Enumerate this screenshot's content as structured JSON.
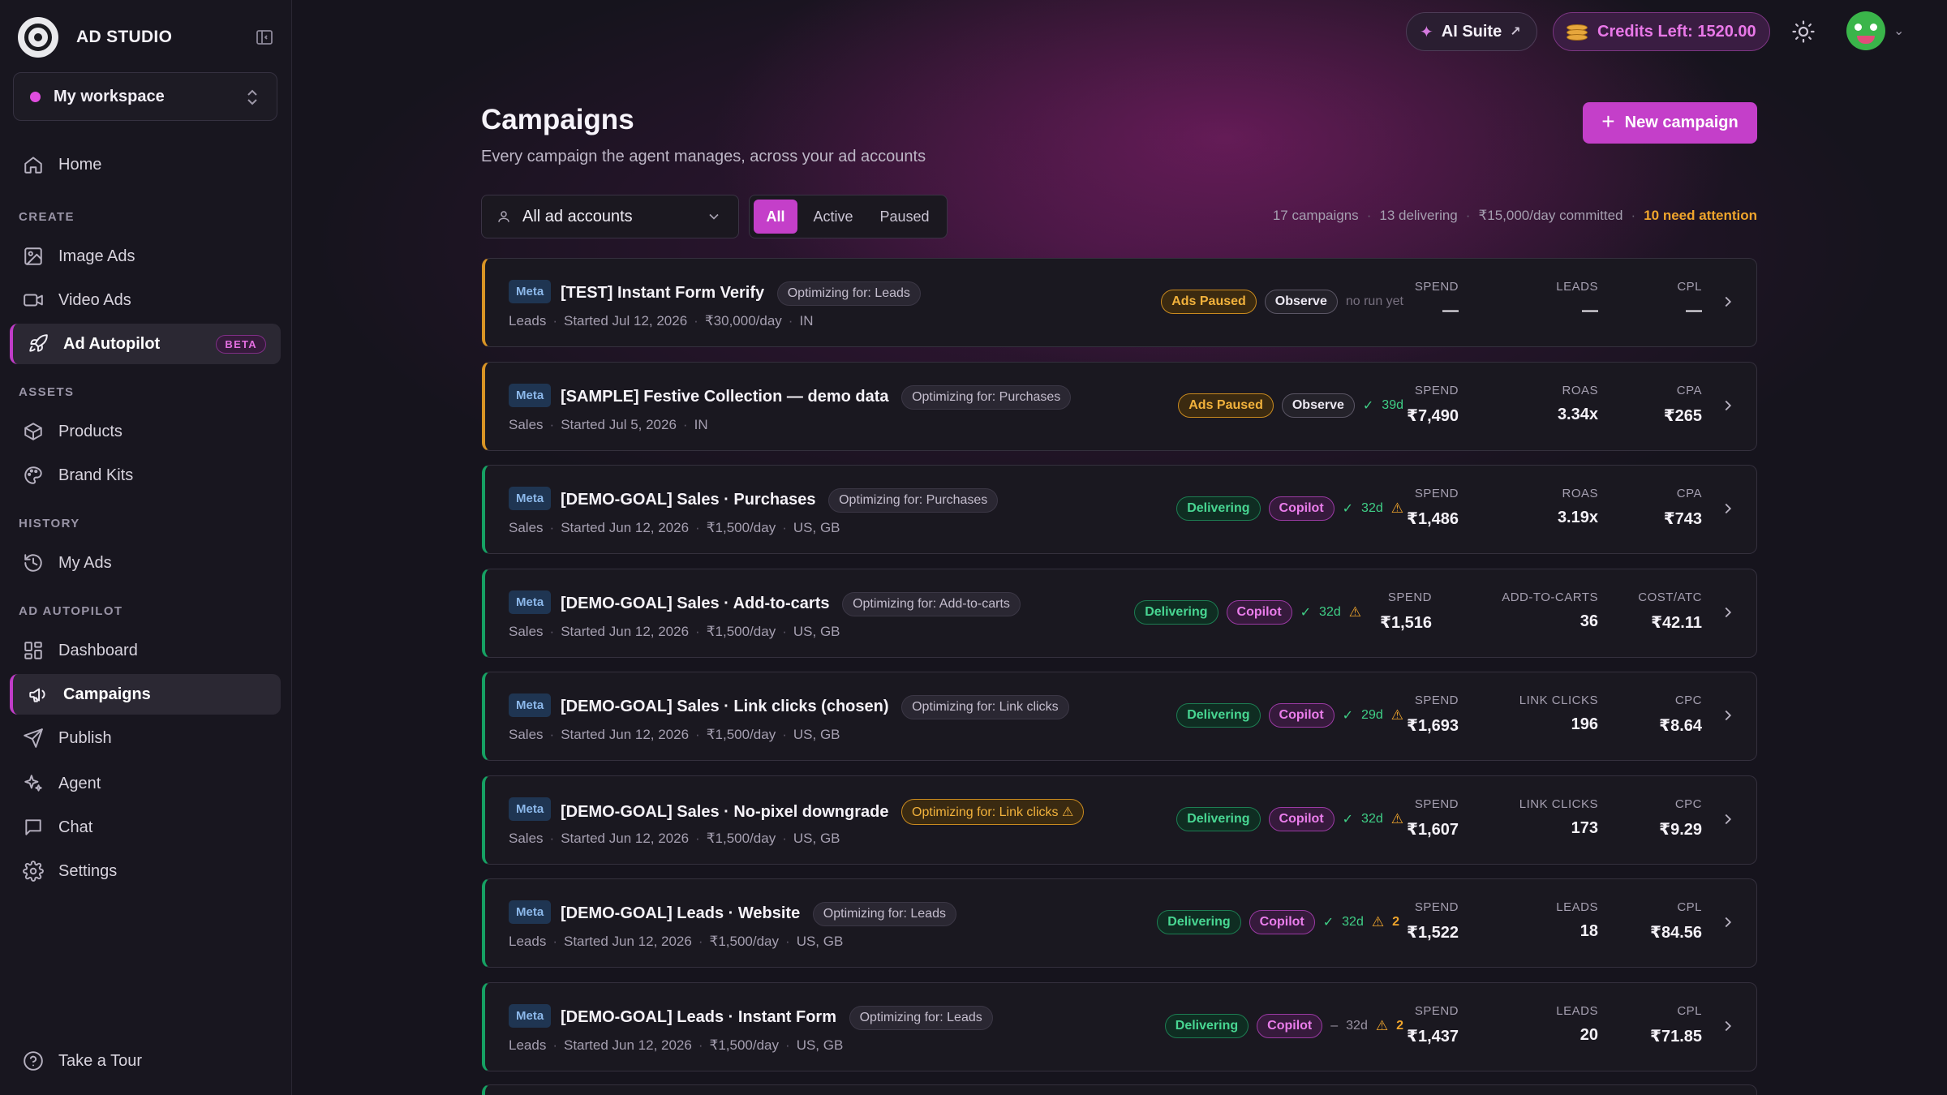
{
  "brand": {
    "name": "AD STUDIO"
  },
  "workspace": {
    "name": "My workspace"
  },
  "nav": {
    "home": "Home",
    "create_section": "CREATE",
    "image_ads": "Image Ads",
    "video_ads": "Video Ads",
    "ad_autopilot": "Ad Autopilot",
    "beta": "BETA",
    "assets_section": "ASSETS",
    "products": "Products",
    "brand_kits": "Brand Kits",
    "history_section": "HISTORY",
    "my_ads": "My Ads",
    "autopilot_section": "AD AUTOPILOT",
    "dashboard": "Dashboard",
    "campaigns": "Campaigns",
    "publish": "Publish",
    "agent": "Agent",
    "chat": "Chat",
    "settings": "Settings",
    "tour": "Take a Tour"
  },
  "topbar": {
    "ai_suite": "AI Suite",
    "credits": "Credits Left: 1520.00"
  },
  "page": {
    "title": "Campaigns",
    "subtitle": "Every campaign the agent manages, across your ad accounts",
    "new_campaign": "New campaign"
  },
  "filters": {
    "accounts": "All ad accounts",
    "tabs": [
      "All",
      "Active",
      "Paused"
    ],
    "selected_tab": "All"
  },
  "summary": {
    "campaigns": "17 campaigns",
    "delivering": "13 delivering",
    "committed": "₹15,000/day committed",
    "attention": "10 need attention"
  },
  "colors": {
    "accent": "#c43fc9",
    "delivering": "#48d692",
    "paused": "#f2b23c",
    "meta_tag": "#8cb8ea"
  },
  "campaigns": [
    {
      "platform": "Meta",
      "name": "[TEST] Instant Form Verify",
      "optimizing": "Optimizing for: Leads",
      "objective": "Leads",
      "started": "Started Jul 12, 2026",
      "budget": "₹30,000/day",
      "geo": "IN",
      "status": "Ads Paused",
      "mode": "Observe",
      "run": "no run yet",
      "m1_label": "SPEND",
      "m1_value": "—",
      "m2_label": "LEADS",
      "m2_value": "—",
      "m3_label": "CPL",
      "m3_value": "—"
    },
    {
      "platform": "Meta",
      "name": "[SAMPLE] Festive Collection — demo data",
      "optimizing": "Optimizing for: Purchases",
      "objective": "Sales",
      "started": "Started Jul 5, 2026",
      "budget": "",
      "geo": "IN",
      "status": "Ads Paused",
      "mode": "Observe",
      "run": "39d",
      "m1_label": "SPEND",
      "m1_value": "₹7,490",
      "m2_label": "ROAS",
      "m2_value": "3.34x",
      "m3_label": "CPA",
      "m3_value": "₹265"
    },
    {
      "platform": "Meta",
      "name": "[DEMO-GOAL] Sales · Purchases",
      "optimizing": "Optimizing for: Purchases",
      "objective": "Sales",
      "started": "Started Jun 12, 2026",
      "budget": "₹1,500/day",
      "geo": "US, GB",
      "status": "Delivering",
      "mode": "Copilot",
      "run": "32d",
      "m1_label": "SPEND",
      "m1_value": "₹1,486",
      "m2_label": "ROAS",
      "m2_value": "3.19x",
      "m3_label": "CPA",
      "m3_value": "₹743"
    },
    {
      "platform": "Meta",
      "name": "[DEMO-GOAL] Sales · Add-to-carts",
      "optimizing": "Optimizing for: Add-to-carts",
      "objective": "Sales",
      "started": "Started Jun 12, 2026",
      "budget": "₹1,500/day",
      "geo": "US, GB",
      "status": "Delivering",
      "mode": "Copilot",
      "run": "32d",
      "m1_label": "SPEND",
      "m1_value": "₹1,516",
      "m2_label": "ADD-TO-CARTS",
      "m2_value": "36",
      "m3_label": "COST/ATC",
      "m3_value": "₹42.11"
    },
    {
      "platform": "Meta",
      "name": "[DEMO-GOAL] Sales · Link clicks (chosen)",
      "optimizing": "Optimizing for: Link clicks",
      "objective": "Sales",
      "started": "Started Jun 12, 2026",
      "budget": "₹1,500/day",
      "geo": "US, GB",
      "status": "Delivering",
      "mode": "Copilot",
      "run": "29d",
      "m1_label": "SPEND",
      "m1_value": "₹1,693",
      "m2_label": "LINK CLICKS",
      "m2_value": "196",
      "m3_label": "CPC",
      "m3_value": "₹8.64"
    },
    {
      "platform": "Meta",
      "name": "[DEMO-GOAL] Sales · No-pixel downgrade",
      "optimizing": "Optimizing for: Link clicks",
      "objective": "Sales",
      "started": "Started Jun 12, 2026",
      "budget": "₹1,500/day",
      "geo": "US, GB",
      "status": "Delivering",
      "mode": "Copilot",
      "run": "32d",
      "m1_label": "SPEND",
      "m1_value": "₹1,607",
      "m2_label": "LINK CLICKS",
      "m2_value": "173",
      "m3_label": "CPC",
      "m3_value": "₹9.29"
    },
    {
      "platform": "Meta",
      "name": "[DEMO-GOAL] Leads · Website",
      "optimizing": "Optimizing for: Leads",
      "objective": "Leads",
      "started": "Started Jun 12, 2026",
      "budget": "₹1,500/day",
      "geo": "US, GB",
      "status": "Delivering",
      "mode": "Copilot",
      "run": "32d",
      "warnings": "2",
      "m1_label": "SPEND",
      "m1_value": "₹1,522",
      "m2_label": "LEADS",
      "m2_value": "18",
      "m3_label": "CPL",
      "m3_value": "₹84.56"
    },
    {
      "platform": "Meta",
      "name": "[DEMO-GOAL] Leads · Instant Form",
      "optimizing": "Optimizing for: Leads",
      "objective": "Leads",
      "started": "Started Jun 12, 2026",
      "budget": "₹1,500/day",
      "geo": "US, GB",
      "status": "Delivering",
      "mode": "Copilot",
      "run": "32d",
      "warnings": "2",
      "m1_label": "SPEND",
      "m1_value": "₹1,437",
      "m2_label": "LEADS",
      "m2_value": "20",
      "m3_label": "CPL",
      "m3_value": "₹71.85"
    }
  ]
}
